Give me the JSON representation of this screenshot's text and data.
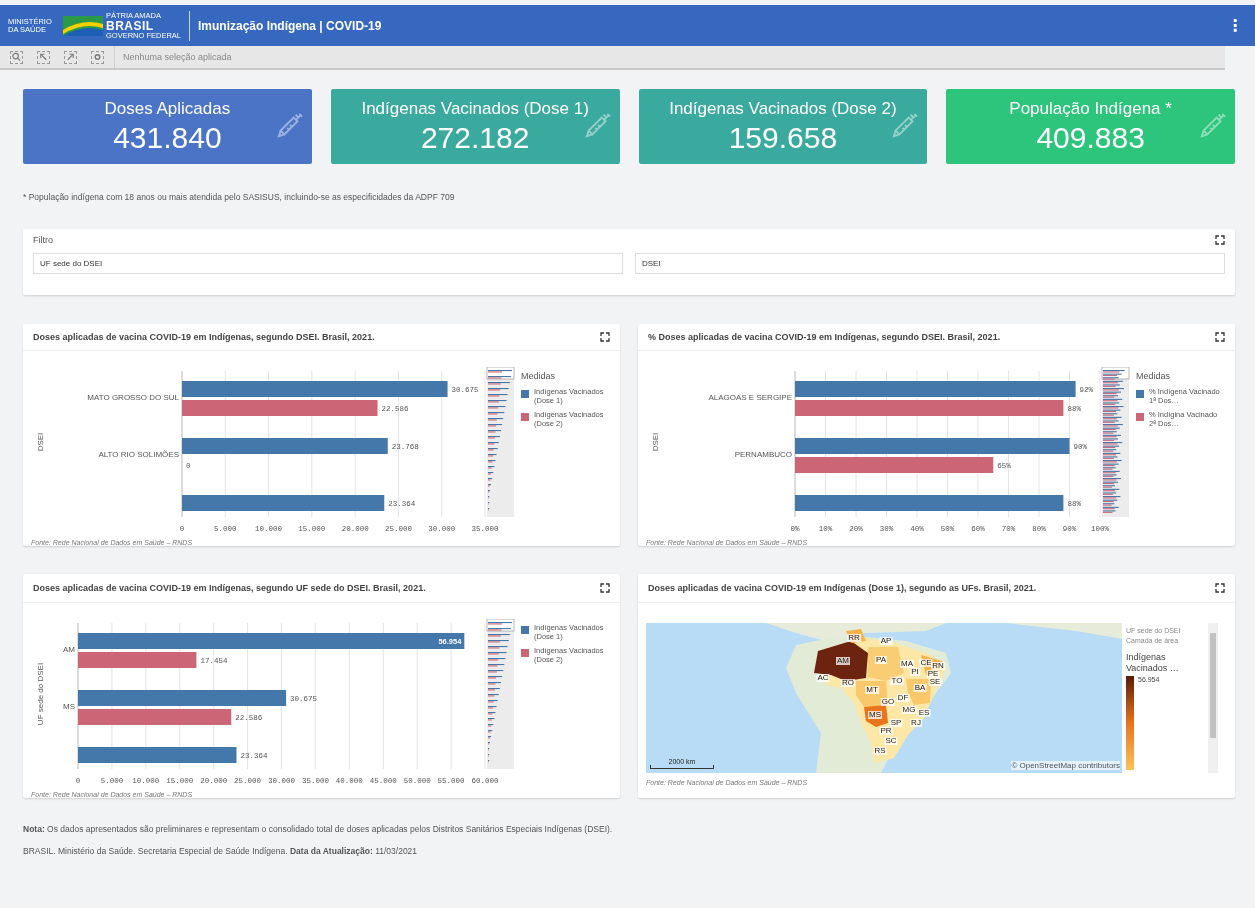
{
  "header": {
    "ministry": "MINISTÉRIO DA SAÚDE",
    "tagline": "PÁTRIA AMADA",
    "brand": "BRASIL",
    "government": "GOVERNO FEDERAL",
    "title": "Imunização Indígena | COVID-19",
    "menu": "⋮"
  },
  "toolbar": {
    "status": "Nenhuma seleção aplicada"
  },
  "kpis": [
    {
      "label": "Doses Aplicadas",
      "value": "431.840",
      "color": "#4b74c6"
    },
    {
      "label": "Indígenas Vacinados (Dose 1)",
      "value": "272.182",
      "color": "#3aa99e"
    },
    {
      "label": "Indígenas Vacinados (Dose 2)",
      "value": "159.658",
      "color": "#3aa99e"
    },
    {
      "label": "População Indígena *",
      "value": "409.883",
      "color": "#2dc47c"
    }
  ],
  "footnote": "* População indígena com 18 anos ou mais atendida pelo SASISUS, incluindo-se as especificidades da ADPF 709",
  "filter": {
    "title": "Filtro",
    "fields": [
      {
        "placeholder": "UF sede do DSEI"
      },
      {
        "placeholder": "DSEI"
      }
    ]
  },
  "bar_panels": [
    {
      "title": "Doses aplicadas de vacina COVID-19 em Indígenas, segundo DSEI. Brasil, 2021.",
      "legend_title": "Medidas",
      "source": "Fonte: Rede Nacional de Dados em Saúde – RNDS",
      "chart_data": {
        "type": "bar",
        "orientation": "horizontal",
        "ylabel": "DSEI",
        "categories": [
          "MATO GROSSO DO SUL",
          "ALTO RIO SOLIMÕES",
          null
        ],
        "series": [
          {
            "name": "Indígenas Vacinados (Dose 1)",
            "color": "#4477aa",
            "values": [
              30675,
              23768,
              23364
            ]
          },
          {
            "name": "Indígenas Vacinados (Dose 2)",
            "color": "#cc6677",
            "values": [
              22586,
              0,
              null
            ]
          }
        ],
        "grid": true,
        "legend": true,
        "value_labels": [
          [
            "30.675",
            "23.768",
            "23.364"
          ],
          [
            "22.586",
            "0",
            null
          ]
        ],
        "xlim": [
          0,
          35000
        ],
        "xticks": [
          0,
          {
            "value": 5000,
            "label": "5.000"
          },
          {
            "value": 10000,
            "label": "10.000"
          },
          {
            "value": 15000,
            "label": "15.000"
          },
          {
            "value": 20000,
            "label": "20.000"
          },
          {
            "value": 25000,
            "label": "25.000"
          },
          {
            "value": 30000,
            "label": "30.000"
          },
          {
            "value": 35000,
            "label": "35.000"
          }
        ]
      }
    },
    {
      "title": "% Doses aplicadas de vacina COVID-19 em Indígenas, segundo DSEI. Brasil, 2021.",
      "legend_title": "Medidas",
      "source": "Fonte: Rede Nacional de Dados em Saúde – RNDS",
      "chart_data": {
        "type": "bar",
        "orientation": "horizontal",
        "ylabel": "DSEI",
        "categories": [
          "ALAGOAS E SERGIPE",
          "PERNAMBUCO",
          null
        ],
        "series": [
          {
            "name": "% Indígena Vacinado 1ª Dos…",
            "color": "#4477aa",
            "values": [
              92,
              90,
              88
            ]
          },
          {
            "name": "% Indígina Vacinado 2ª Dos…",
            "color": "#cc6677",
            "values": [
              88,
              65,
              null
            ]
          }
        ],
        "grid": true,
        "legend": true,
        "value_labels": [
          [
            "92%",
            "90%",
            "88%"
          ],
          [
            "88%",
            "65%",
            null
          ]
        ],
        "xlim": [
          0,
          100
        ],
        "xticks": [
          {
            "value": 0,
            "label": "0%"
          },
          {
            "value": 10,
            "label": "10%"
          },
          {
            "value": 20,
            "label": "20%"
          },
          {
            "value": 30,
            "label": "30%"
          },
          {
            "value": 40,
            "label": "40%"
          },
          {
            "value": 50,
            "label": "50%"
          },
          {
            "value": 60,
            "label": "60%"
          },
          {
            "value": 70,
            "label": "70%"
          },
          {
            "value": 80,
            "label": "80%"
          },
          {
            "value": 90,
            "label": "90%"
          },
          {
            "value": 100,
            "label": "100%"
          }
        ]
      }
    },
    {
      "title": "Doses aplicadas de vacina COVID-19 em Indígenas, segundo UF sede do DSEI. Brasil, 2021.",
      "source": "Fonte: Rede Nacional de Dados em Saúde – RNDS",
      "chart_data": {
        "type": "bar",
        "orientation": "horizontal",
        "ylabel": "UF sede do DSEI",
        "categories": [
          "AM",
          "MS",
          null
        ],
        "series": [
          {
            "name": "Indígenas Vacinados (Dose 1)",
            "color": "#4477aa",
            "values": [
              56954,
              30675,
              23364
            ]
          },
          {
            "name": "Indígenas Vacinados (Dose 2)",
            "color": "#cc6677",
            "values": [
              17454,
              22586,
              null
            ]
          }
        ],
        "grid": true,
        "legend": true,
        "value_labels": [
          [
            "56.954",
            "30.675",
            "23.364"
          ],
          [
            "17.454",
            "22.586",
            null
          ]
        ],
        "xlim": [
          0,
          60000
        ],
        "xticks": [
          0,
          {
            "value": 5000,
            "label": "5.000"
          },
          {
            "value": 10000,
            "label": "10.000"
          },
          {
            "value": 15000,
            "label": "15.000"
          },
          {
            "value": 20000,
            "label": "20.000"
          },
          {
            "value": 25000,
            "label": "25.000"
          },
          {
            "value": 30000,
            "label": "30.000"
          },
          {
            "value": 35000,
            "label": "35.000"
          },
          {
            "value": 40000,
            "label": "40.000"
          },
          {
            "value": 45000,
            "label": "45.000"
          },
          {
            "value": 50000,
            "label": "50.000"
          },
          {
            "value": 55000,
            "label": "55.000"
          },
          {
            "value": 60000,
            "label": "60.000"
          }
        ]
      }
    }
  ],
  "map_panel": {
    "title": "Doses aplicadas de vacina COVID-19 em Indígenas (Dose 1), segundo as UFs. Brasil, 2021.",
    "states": [
      {
        "label": "RR"
      },
      {
        "label": "AP"
      },
      {
        "label": "AM"
      },
      {
        "label": "PA"
      },
      {
        "label": "MA"
      },
      {
        "label": "CE"
      },
      {
        "label": "RN"
      },
      {
        "label": "PI"
      },
      {
        "label": "PE"
      },
      {
        "label": "SE"
      },
      {
        "label": "AC"
      },
      {
        "label": "RO"
      },
      {
        "label": "TO"
      },
      {
        "label": "BA"
      },
      {
        "label": "MT"
      },
      {
        "label": "GO"
      },
      {
        "label": "DF"
      },
      {
        "label": "MG"
      },
      {
        "label": "ES"
      },
      {
        "label": "MS"
      },
      {
        "label": "SP"
      },
      {
        "label": "RJ"
      },
      {
        "label": "PR"
      },
      {
        "label": "SC"
      },
      {
        "label": "RS"
      }
    ],
    "legend": {
      "dimension": "UF sede do DSEI",
      "layer": "Camada de área",
      "measure": "Indígenas Vacinados …",
      "max": "56.954"
    },
    "scale": "2000 km",
    "attribution": "© OpenStreetMap contributors",
    "source": "Fonte: Rede Nacional de Dados em Saúde – RNDS"
  },
  "notes": [
    "**Nota:** Os dados apresentados são preliminares e representam o consolidado total de doses aplicadas pelos Distritos Sanitários Especiais Indígenas (DSEI).",
    "BRASIL. Ministério da Saúde. Secretaria Especial de Saúde Indígena. **Data da Atualização:** 11/03/2021"
  ]
}
